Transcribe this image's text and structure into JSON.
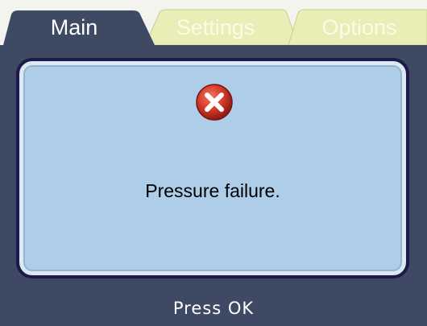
{
  "tabs": {
    "main": "Main",
    "settings": "Settings",
    "options": "Options"
  },
  "dialog": {
    "icon": "error-x-icon",
    "message": "Pressure failure."
  },
  "footer": {
    "prompt": "Press OK"
  },
  "colors": {
    "active_tab": "#3e4a64",
    "inactive_tab": "#e9edb6",
    "dialog_background": "#aecde8",
    "dialog_border": "#1c1a4a",
    "error_red": "#d63a2a"
  }
}
